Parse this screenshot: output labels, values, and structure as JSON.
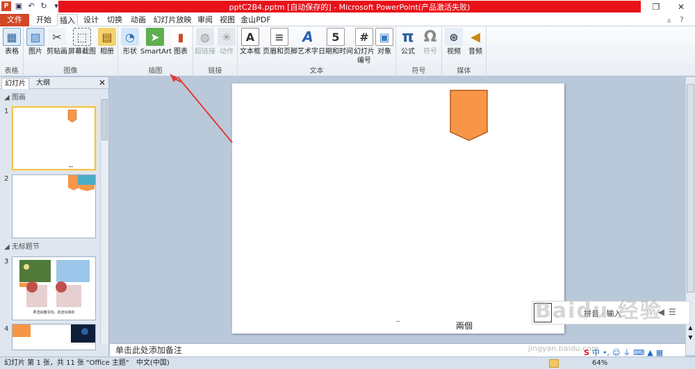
{
  "window": {
    "title": "pptC2B4.pptm [自动保存的] - Microsoft PowerPoint(产品激活失败)",
    "app_icon": "P"
  },
  "tabs": [
    "文件",
    "开始",
    "插入",
    "设计",
    "切换",
    "动画",
    "幻灯片放映",
    "审阅",
    "视图",
    "金山PDF"
  ],
  "active_tab": "插入",
  "ribbon": {
    "groups": {
      "table": "表格",
      "images": "图像",
      "illustrations": "插图",
      "links": "链接",
      "text": "文本",
      "symbols": "符号",
      "media": "媒体"
    },
    "buttons": {
      "table": "表格",
      "picture": "图片",
      "clipart": "剪贴画",
      "screenshot": "屏幕截图",
      "album": "相册",
      "shapes": "形状",
      "smartart": "SmartArt",
      "chart": "图表",
      "hyperlink": "超链接",
      "action": "动作",
      "textbox": "文本框",
      "headerfooter": "页眉和页脚",
      "wordart": "艺术字",
      "datetime": "日期和时间",
      "slidenumber": "幻灯片\n编号",
      "object": "对象",
      "equation": "公式",
      "symbol": "符号",
      "video": "视频",
      "audio": "音频"
    }
  },
  "left_pane": {
    "tabs": [
      "幻灯片",
      "大纲"
    ],
    "sections": [
      "图画",
      "无标题节"
    ],
    "slides": [
      "1",
      "2",
      "3",
      "4"
    ],
    "slide3_caption": "照渲染器寻找，前途似锦的"
  },
  "slide": {
    "footer_text": "兩個"
  },
  "notes_placeholder": "单击此处添加备注",
  "status": {
    "slide_info": "幻灯片 第 1 张，共 11 张",
    "theme": "\"Office 主题\"",
    "language": "中文(中国)",
    "zoom": "64%"
  },
  "ime": {
    "text": "拼音 · 输入",
    "mode": "中"
  },
  "watermark": {
    "logo": "Baidu 经验",
    "url": "jingyan.baidu.com"
  },
  "colors": {
    "accent": "#d24726",
    "shape_fill": "#f79646",
    "shape_stroke": "#b35a1f",
    "title_red": "#e8121a"
  }
}
